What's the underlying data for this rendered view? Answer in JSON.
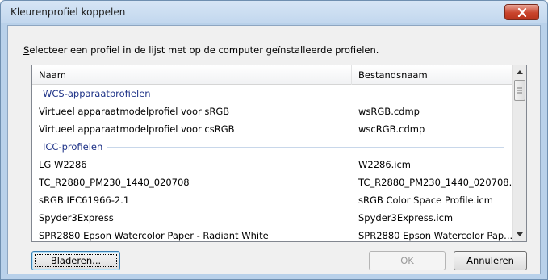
{
  "window": {
    "title": "Kleurenprofiel koppelen",
    "close_icon": "close-icon"
  },
  "instruction": {
    "accel": "S",
    "rest": "electeer een profiel in de lijst met op de computer geïnstalleerde profielen."
  },
  "list": {
    "columns": [
      "Naam",
      "Bestandsnaam"
    ],
    "groups": [
      {
        "label": "WCS-apparaatprofielen",
        "rows": [
          {
            "name": "Virtueel apparaatmodelprofiel voor sRGB",
            "file": "wsRGB.cdmp"
          },
          {
            "name": "Virtueel apparaatmodelprofiel voor csRGB",
            "file": "wscRGB.cdmp"
          }
        ]
      },
      {
        "label": "ICC-profielen",
        "rows": [
          {
            "name": "LG W2286",
            "file": "W2286.icm"
          },
          {
            "name": "TC_R2880_PM230_1440_020708",
            "file": "TC_R2880_PM230_1440_020708..."
          },
          {
            "name": "sRGB IEC61966-2.1",
            "file": "sRGB Color Space Profile.icm"
          },
          {
            "name": "Spyder3Express",
            "file": "Spyder3Express.icm"
          },
          {
            "name": "SPR2880 Epson Watercolor Paper - Radiant White",
            "file": "SPR2880 Epson Watercolor Pap..."
          }
        ]
      }
    ]
  },
  "buttons": {
    "browse_accel": "B",
    "browse_rest": "laderen...",
    "ok": "OK",
    "cancel": "Annuleren"
  },
  "colors": {
    "group_label": "#1e3287",
    "close_button": "#c9442c"
  }
}
